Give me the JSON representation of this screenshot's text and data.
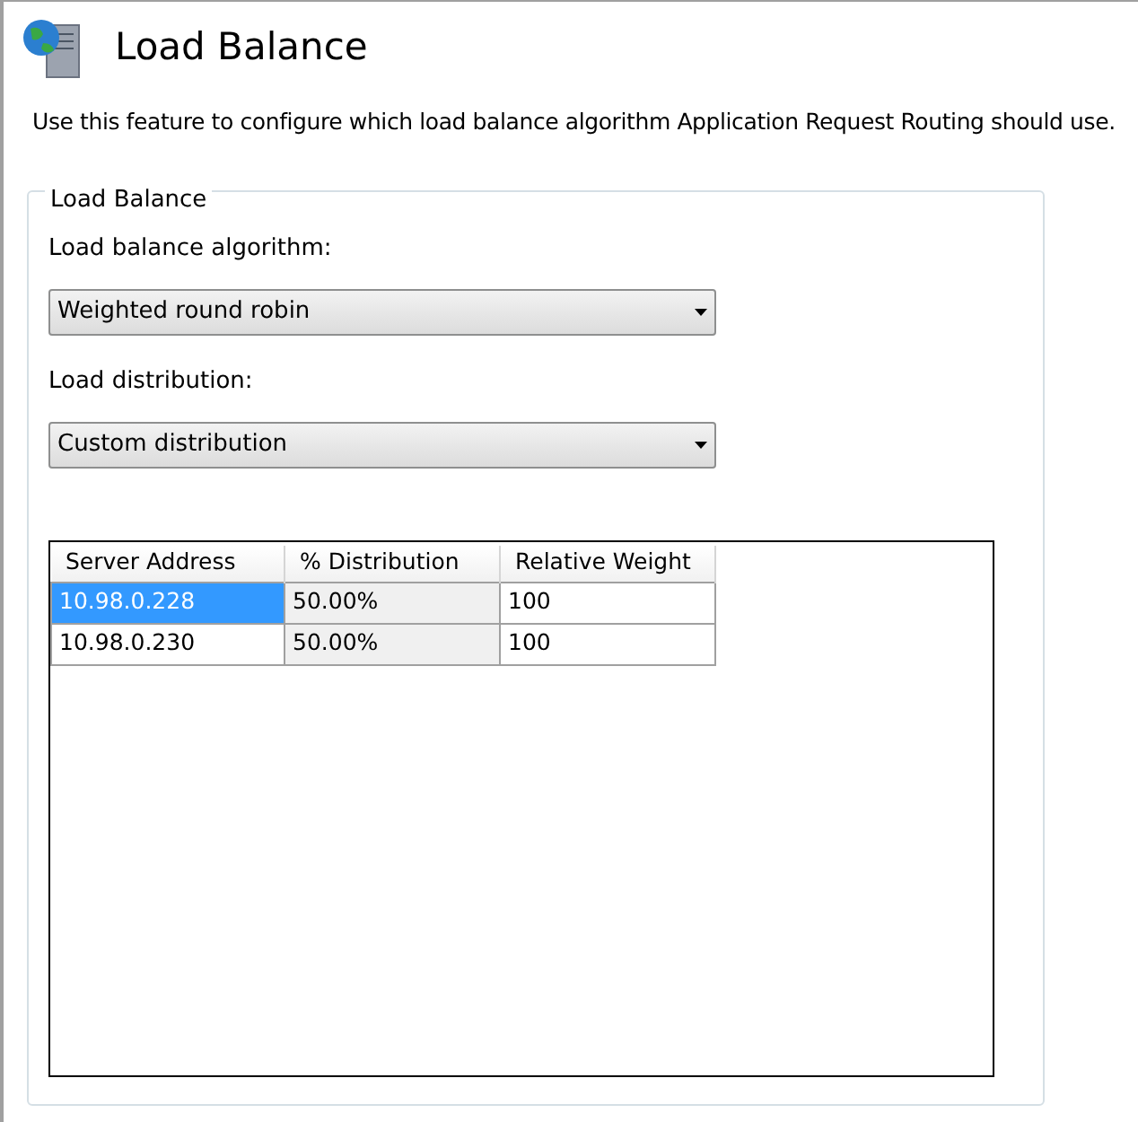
{
  "header": {
    "title": "Load Balance"
  },
  "description": "Use this feature to configure which load balance algorithm Application Request Routing should use.",
  "group": {
    "title": "Load Balance",
    "fields": [
      {
        "label": "Load balance algorithm:",
        "value": "Weighted round robin"
      },
      {
        "label": "Load distribution:",
        "value": "Custom distribution"
      }
    ],
    "table": {
      "columns": [
        {
          "label": "Server Address",
          "read_only": false
        },
        {
          "label": "% Distribution",
          "read_only": true
        },
        {
          "label": "Relative Weight",
          "read_only": false
        }
      ],
      "rows": [
        {
          "selected": true,
          "cells": [
            "10.98.0.228",
            "50.00%",
            "100"
          ]
        },
        {
          "selected": false,
          "cells": [
            "10.98.0.230",
            "50.00%",
            "100"
          ]
        }
      ]
    }
  }
}
